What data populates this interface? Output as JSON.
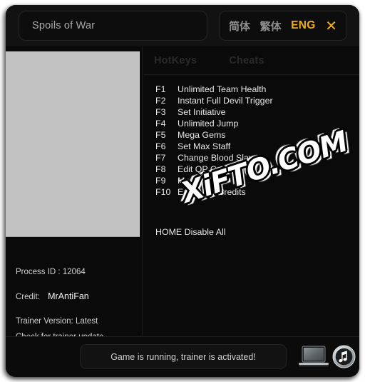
{
  "window": {
    "title": "Spoils of War"
  },
  "languages": {
    "simplified": "简体",
    "traditional": "繁体",
    "english": "ENG",
    "active": "ENG",
    "close_label": "✕",
    "accent_color": "#f0ad15"
  },
  "tabs": [
    {
      "id": "hotkeys",
      "label": "HotKeys",
      "active": true
    },
    {
      "id": "cheats",
      "label": "Cheats",
      "active": false
    }
  ],
  "hotkeys": [
    {
      "key": "F1",
      "desc": "Unlimited Team Health"
    },
    {
      "key": "F2",
      "desc": "Instant Full Devil Trigger"
    },
    {
      "key": "F3",
      "desc": "Set Initiative"
    },
    {
      "key": "F4",
      "desc": "Unlimited Jump"
    },
    {
      "key": "F5",
      "desc": "Mega Gems"
    },
    {
      "key": "F6",
      "desc": "Set Max Staff"
    },
    {
      "key": "F7",
      "desc": "Change Blood Slaves"
    },
    {
      "key": "F8",
      "desc": "Edit QP Credits"
    },
    {
      "key": "F9",
      "desc": "Max Tension"
    },
    {
      "key": "F10",
      "desc": "Earn Max Credits"
    }
  ],
  "disable_all": "HOME Disable All",
  "info": {
    "process_id_label": "Process ID :",
    "process_id_value": "12064",
    "credit_label": "Credit:",
    "credit_value": "MrAntiFan",
    "trainer_version": "Trainer Version: Latest",
    "update_link": "Check for trainer update"
  },
  "status": {
    "message": "Game is running, trainer is activated!"
  },
  "watermark": {
    "text": "XiFTO.COM"
  },
  "icons": {
    "laptop": "laptop-icon",
    "music": "music-note-icon"
  }
}
